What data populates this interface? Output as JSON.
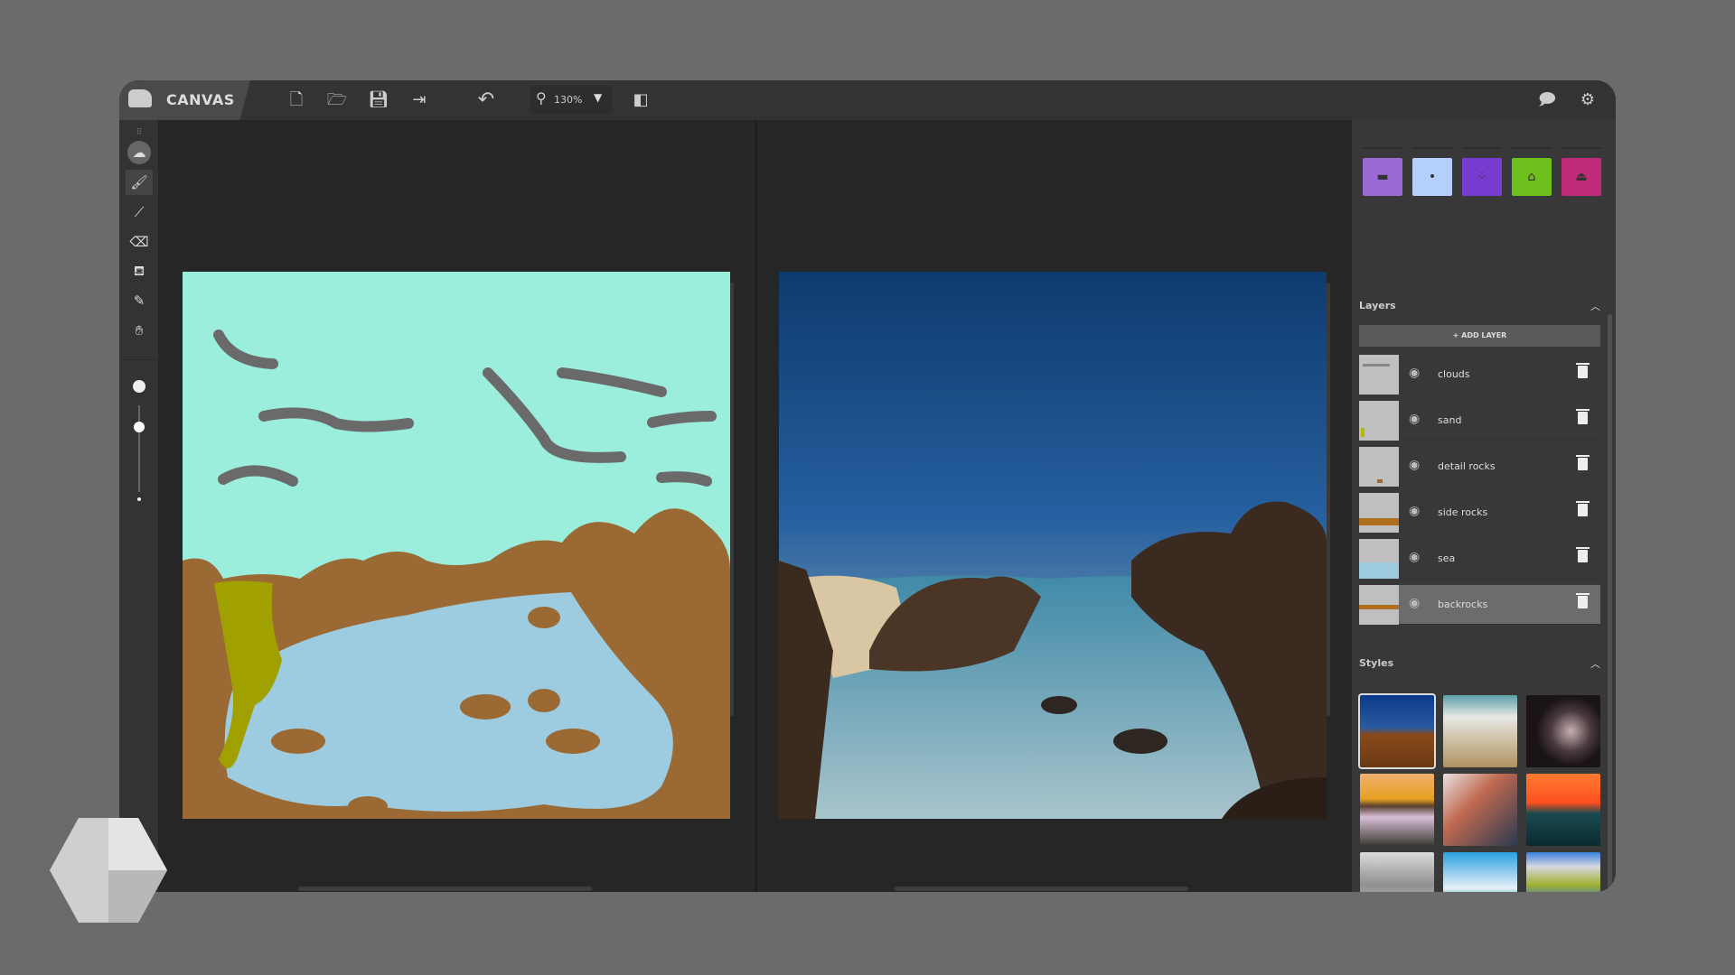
{
  "app": {
    "title": "CANVAS"
  },
  "toolbar": {
    "icons": [
      "new-file-icon",
      "open-folder-icon",
      "save-icon",
      "export-icon",
      "undo-icon",
      "zoom-icon",
      "layout-toggle-icon",
      "feedback-icon",
      "settings-icon"
    ],
    "zoom_value": "130%"
  },
  "tools": [
    "drag-handle",
    "material-brush",
    "brush",
    "line",
    "eraser",
    "fill",
    "eyedropper",
    "pan"
  ],
  "brush_size_fraction": 0.75,
  "materials": {
    "swatches": [
      {
        "name": "fog",
        "color": "#9b6ad6"
      },
      {
        "name": "snow",
        "color": "#b4cffc"
      },
      {
        "name": "stars",
        "color": "#7a3bd1"
      },
      {
        "name": "house",
        "color": "#6fc01c"
      },
      {
        "name": "platform",
        "color": "#c02c7a"
      }
    ]
  },
  "layers": {
    "title": "Layers",
    "add_label": "+ ADD LAYER",
    "items": [
      {
        "name": "clouds",
        "selected": false
      },
      {
        "name": "sand",
        "selected": false
      },
      {
        "name": "detail rocks",
        "selected": false
      },
      {
        "name": "side rocks",
        "selected": false
      },
      {
        "name": "sea",
        "selected": false
      },
      {
        "name": "backrocks",
        "selected": true
      }
    ]
  },
  "styles": {
    "title": "Styles",
    "selected_index": 0,
    "count": 9
  },
  "colors": {
    "sky": "#9beedb",
    "water": "#9dcbe0",
    "rock": "#9b6a34",
    "sand": "#a0a000",
    "cloud": "#6a6a6a"
  }
}
